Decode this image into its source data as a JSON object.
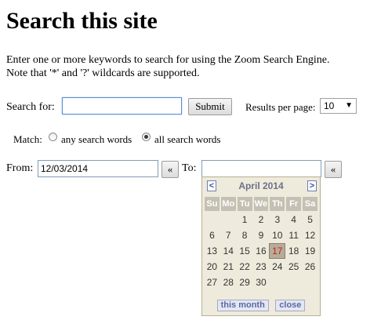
{
  "page": {
    "title": "Search this site",
    "intro_line1": "Enter one or more keywords to search for using the Zoom Search Engine.",
    "intro_line2": "Note that '*' and '?' wildcards are supported."
  },
  "search": {
    "label": "Search for:",
    "value": "",
    "submit_label": "Submit",
    "results_label": "Results per page:",
    "results_value": "10"
  },
  "match": {
    "label": "Match:",
    "option_any": "any search words",
    "option_all": "all search words",
    "selected": "all"
  },
  "dates": {
    "from_label": "From:",
    "from_value": "12/03/2014",
    "to_label": "To:",
    "to_value": "",
    "picker_button": "«"
  },
  "calendar": {
    "title": "April 2014",
    "prev": "<",
    "next": ">",
    "weekdays": [
      "Su",
      "Mo",
      "Tu",
      "We",
      "Th",
      "Fr",
      "Sa"
    ],
    "weeks": [
      [
        "",
        "",
        "1",
        "2",
        "3",
        "4",
        "5"
      ],
      [
        "6",
        "7",
        "8",
        "9",
        "10",
        "11",
        "12"
      ],
      [
        "13",
        "14",
        "15",
        "16",
        "17",
        "18",
        "19"
      ],
      [
        "20",
        "21",
        "22",
        "23",
        "24",
        "25",
        "26"
      ],
      [
        "27",
        "28",
        "29",
        "30",
        "",
        "",
        ""
      ]
    ],
    "today": "17",
    "this_month_label": "this month",
    "close_label": "close"
  }
}
